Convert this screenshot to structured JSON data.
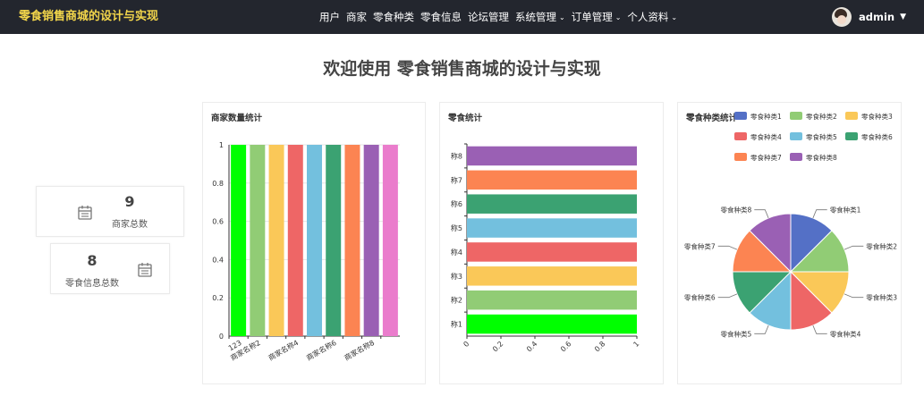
{
  "app": {
    "title": "零食销售商城的设计与实现"
  },
  "nav": {
    "items": [
      {
        "label": "用户",
        "dropdown": false
      },
      {
        "label": "商家",
        "dropdown": false
      },
      {
        "label": "零食种类",
        "dropdown": false
      },
      {
        "label": "零食信息",
        "dropdown": false
      },
      {
        "label": "论坛管理",
        "dropdown": false
      },
      {
        "label": "系统管理",
        "dropdown": true
      },
      {
        "label": "订单管理",
        "dropdown": true
      },
      {
        "label": "个人资料",
        "dropdown": true
      }
    ]
  },
  "user": {
    "name": "admin",
    "caret": "▼"
  },
  "welcome": {
    "title": "欢迎使用 零食销售商城的设计与实现"
  },
  "stats": [
    {
      "value": "9",
      "label": "商家总数",
      "icon": "calendar-icon"
    },
    {
      "value": "8",
      "label": "零食信息总数",
      "icon": "calendar-icon"
    }
  ],
  "colors": [
    "#00ff00",
    "#91cc75",
    "#fac858",
    "#ee6666",
    "#73c0de",
    "#3ba272",
    "#fc8452",
    "#9a60b4",
    "#ea7ccc",
    "#5470c6"
  ],
  "chart_data": [
    {
      "type": "bar",
      "title": "商家数量统计",
      "categories": [
        "123",
        "商家名称2",
        "",
        "商家名称4",
        "",
        "商家名称6",
        "",
        "商家名称8",
        ""
      ],
      "values": [
        1,
        1,
        1,
        1,
        1,
        1,
        1,
        1,
        1
      ],
      "ylim": [
        0,
        1
      ],
      "yticks": [
        "0",
        "0.2",
        "0.4",
        "0.6",
        "0.8",
        "1"
      ],
      "grid": true
    },
    {
      "type": "bar",
      "orientation": "horizontal",
      "title": "零食统计",
      "categories": [
        "称1",
        "称2",
        "称3",
        "称4",
        "称5",
        "称6",
        "称7",
        "称8"
      ],
      "values": [
        1,
        1,
        1,
        1,
        1,
        1,
        1,
        1
      ],
      "xlim": [
        0,
        1
      ],
      "xticks": [
        "0",
        "0.2",
        "0.4",
        "0.6",
        "0.8",
        "1"
      ]
    },
    {
      "type": "pie",
      "title": "零食种类统计",
      "categories": [
        "零食种类1",
        "零食种类2",
        "零食种类3",
        "零食种类4",
        "零食种类5",
        "零食种类6",
        "零食种类7",
        "零食种类8"
      ],
      "values": [
        1,
        1,
        1,
        1,
        1,
        1,
        1,
        1
      ],
      "colors": [
        "#5470c6",
        "#91cc75",
        "#fac858",
        "#ee6666",
        "#73c0de",
        "#3ba272",
        "#fc8452",
        "#9a60b4"
      ],
      "legend": "top"
    }
  ]
}
